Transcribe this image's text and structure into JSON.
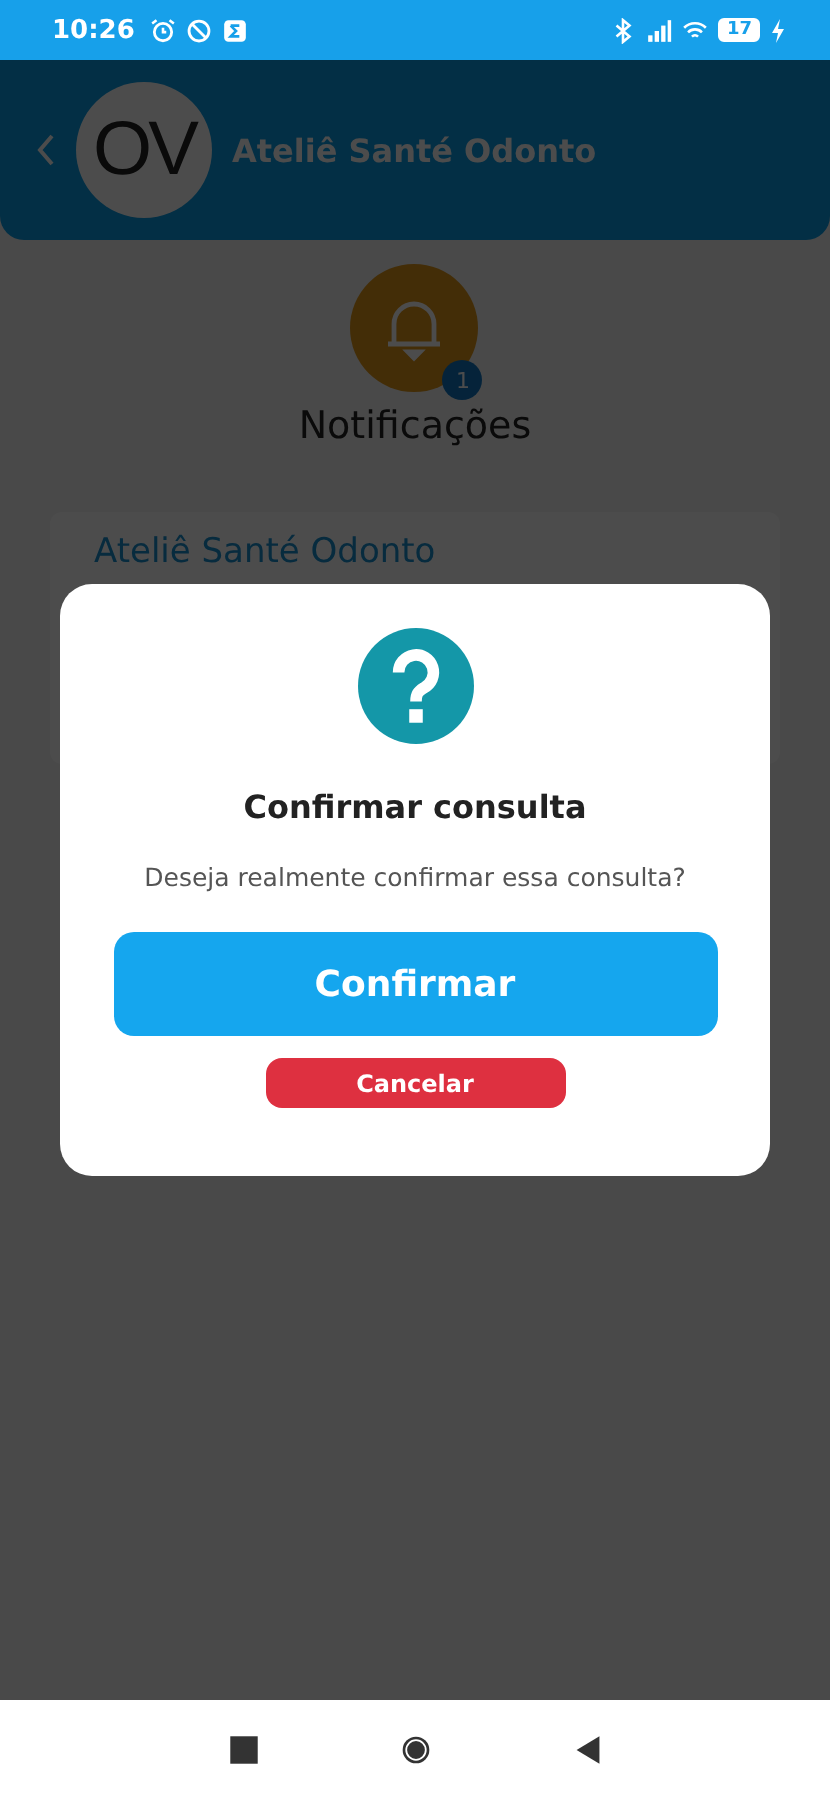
{
  "status_bar": {
    "time": "10:26",
    "battery": "17"
  },
  "header": {
    "logo": "OV",
    "title": "Ateliê Santé Odonto"
  },
  "notifications": {
    "badge": "1",
    "label": "Notificações"
  },
  "card": {
    "title": "Ateliê Santé Odonto"
  },
  "dialog": {
    "title": "Confirmar consulta",
    "message": "Deseja realmente confirmar essa consulta?",
    "buttons": [
      {
        "kind": "primary",
        "label": "Confirmar"
      },
      {
        "kind": "danger",
        "label": "Cancelar"
      }
    ]
  }
}
